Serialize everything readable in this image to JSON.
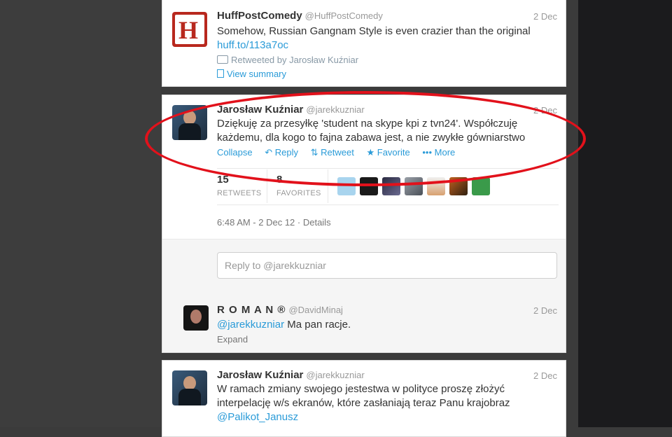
{
  "tweet1": {
    "name": "HuffPostComedy",
    "handle": "@HuffPostComedy",
    "date": "2 Dec",
    "text": "Somehow, Russian Gangnam Style is even crazier than the original",
    "link": "huff.to/113a7oc",
    "retweeted_by": "Retweeted by Jarosław Kuźniar",
    "view_summary": "View summary",
    "avatar_letter": "H"
  },
  "tweet2": {
    "name": "Jarosław Kuźniar",
    "handle": "@jarekkuzniar",
    "date": "2 Dec",
    "text_line1": "Dziękuję za przesyłkę 'student na skype kpi z tvn24'. Współczuję",
    "text_line2": "każdemu, dla kogo to fajna zabawa jest, a nie zwykłe gówniarstwo",
    "actions": {
      "collapse": "Collapse",
      "reply": "Reply",
      "retweet": "Retweet",
      "favorite": "Favorite",
      "more": "More"
    },
    "retweets_count": "15",
    "retweets_label": "RETWEETS",
    "favorites_count": "8",
    "favorites_label": "FAVORITES",
    "timestamp": "6:48 AM - 2 Dec 12 · Details",
    "reply_placeholder": "Reply to @jarekkuzniar"
  },
  "reply": {
    "name": "R O M A N ®",
    "handle": "@DavidMinaj",
    "date": "2 Dec",
    "mention": "@jarekkuzniar",
    "text": "Ma pan racje.",
    "expand": "Expand"
  },
  "tweet3": {
    "name": "Jarosław Kuźniar",
    "handle": "@jarekkuzniar",
    "date": "2 Dec",
    "text_line1": "W ramach zmiany swojego jestestwa w polityce proszę złożyć",
    "text_line2": "interpelację w/s ekranów, które zasłaniają teraz Panu krajobraz",
    "mention": "@Palikot_Janusz"
  },
  "colors": {
    "link": "#2a9bd8",
    "annotation": "#e2111b"
  }
}
